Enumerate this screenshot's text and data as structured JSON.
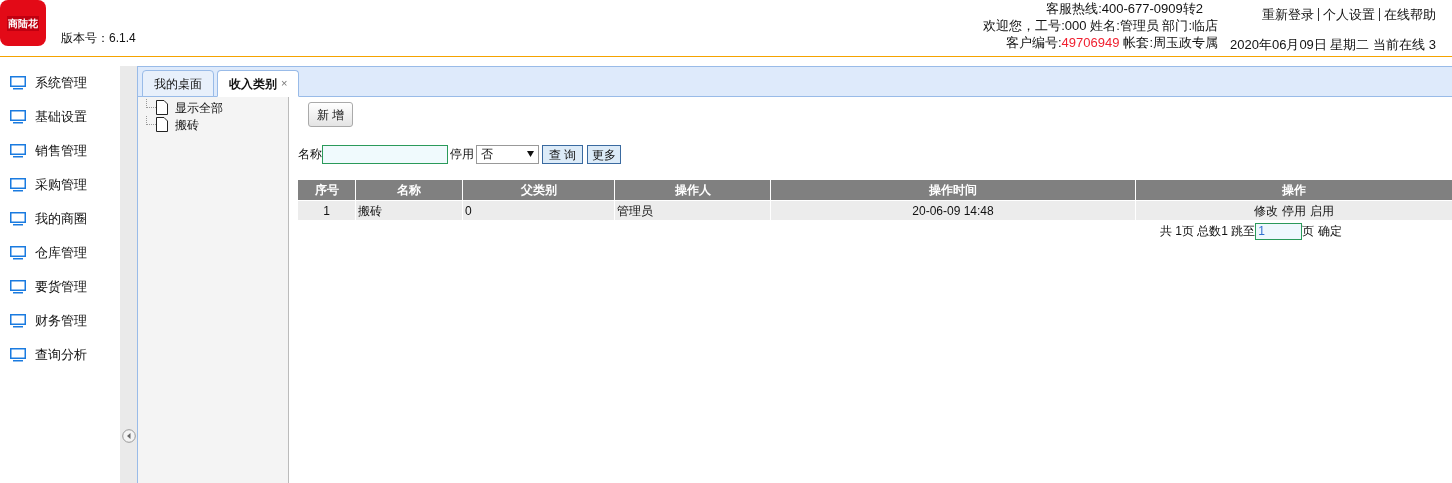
{
  "header": {
    "logo_text": "商陆花",
    "version": "版本号：6.1.4",
    "hotline": "客服热线:400-677-0909转2",
    "welcome": "欢迎您，工号:000 姓名:管理员 部门:临店",
    "customer_label": "客户编号:",
    "customer_no": "49706949",
    "account": "帐套:周玉政专属",
    "links": [
      "重新登录",
      "个人设置",
      "在线帮助"
    ],
    "date_line": "2020年06月09日 星期二 当前在线 3"
  },
  "sidebar": {
    "items": [
      {
        "label": "系统管理"
      },
      {
        "label": "基础设置"
      },
      {
        "label": "销售管理"
      },
      {
        "label": "采购管理"
      },
      {
        "label": "我的商圈"
      },
      {
        "label": "仓库管理"
      },
      {
        "label": "要货管理"
      },
      {
        "label": "财务管理"
      },
      {
        "label": "查询分析"
      }
    ]
  },
  "tabs": [
    {
      "label": "我的桌面",
      "selected": false
    },
    {
      "label": "收入类别",
      "selected": true,
      "close": "×"
    }
  ],
  "tree": {
    "items": [
      {
        "label": "显示全部"
      },
      {
        "label": "搬砖"
      }
    ]
  },
  "toolbar": {
    "add_button": "新 增"
  },
  "filter": {
    "name_label": "名称",
    "disabled_label": "停用",
    "disabled_value": "否",
    "query_button": "查 询",
    "more_button": "更多"
  },
  "table": {
    "columns": [
      "序号",
      "名称",
      "父类别",
      "操作人",
      "操作时间",
      "操作"
    ],
    "rows": [
      {
        "cells": [
          "1",
          "搬砖",
          "0",
          "管理员",
          "20-06-09 14:48"
        ],
        "actions": [
          "修改",
          "停用",
          "启用"
        ]
      }
    ]
  },
  "pagination": {
    "before": "共 1页 总数1 跳至",
    "page": "1",
    "after": "页",
    "confirm": "确定"
  }
}
